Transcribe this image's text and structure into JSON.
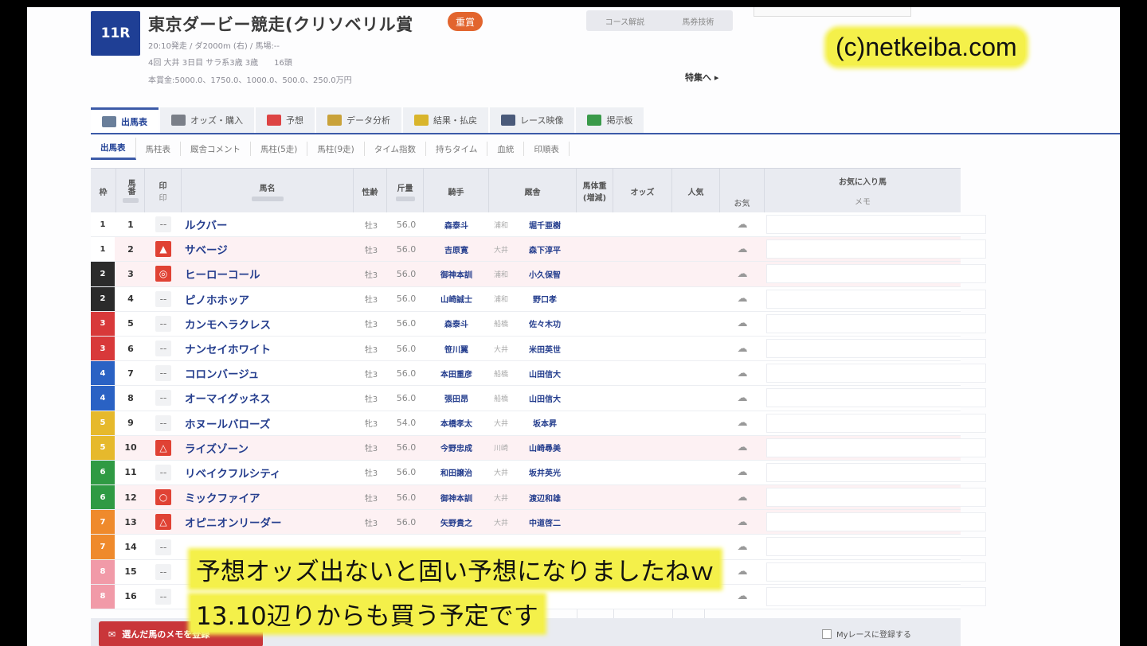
{
  "header": {
    "race_no": "11R",
    "title": "東京ダービー競走(クリソベリル賞",
    "grade": "重賞",
    "meta1": "20:10発走 / ダ2000m (右) / 馬場:--",
    "meta2": "4回 大井 3日目 サラ系3歳 3歳　　16頭",
    "meta3": "本賞金:5000.0、1750.0、1000.0、500.0、250.0万円",
    "course_btn1": "コース解説",
    "course_btn2": "馬券技術",
    "special_link": "特集へ ▸"
  },
  "watermark": "(c)netkeiba.com",
  "tabs": [
    {
      "label": "出馬表",
      "color": "#6a7f9a"
    },
    {
      "label": "オッズ・購入",
      "color": "#7a7f88"
    },
    {
      "label": "予想",
      "color": "#d44"
    },
    {
      "label": "データ分析",
      "color": "#c9a23a"
    },
    {
      "label": "結果・払戻",
      "color": "#d9b52c"
    },
    {
      "label": "レース映像",
      "color": "#4a5a7a"
    },
    {
      "label": "掲示板",
      "color": "#3a9a4a"
    }
  ],
  "subtabs": [
    "出馬表",
    "馬柱表",
    "厩舎コメント",
    "馬柱(5走)",
    "馬柱(9走)",
    "タイム指数",
    "持ちタイム",
    "血統",
    "印順表"
  ],
  "columns": {
    "waku": "枠",
    "uma": "馬番",
    "mark": "印",
    "mark_sub": "印",
    "name": "馬名",
    "sexage": "性齢",
    "weight": "斤量",
    "jockey": "騎手",
    "trainer": "厩舎",
    "bodyweight": "馬体重(増減)",
    "odds": "オッズ",
    "popular": "人気",
    "fav": "お気",
    "memo_head": "お気に入り馬",
    "memo_sub": "メモ"
  },
  "horses": [
    {
      "waku": "1",
      "uma": "1",
      "mark": "--",
      "name": "ルクバー",
      "sexage": "牡3",
      "weight": "56.0",
      "jockey": "森泰斗",
      "region": "浦和",
      "trainer": "堀千亜樹",
      "pink": false,
      "red": false,
      "waku_color": "#ffffff",
      "waku_text": "#333"
    },
    {
      "waku": "1",
      "uma": "2",
      "mark": "▲",
      "name": "サベージ",
      "sexage": "牡3",
      "weight": "56.0",
      "jockey": "吉原寛",
      "region": "大井",
      "trainer": "森下淳平",
      "pink": true,
      "red": true,
      "waku_color": "#ffffff",
      "waku_text": "#333"
    },
    {
      "waku": "2",
      "uma": "3",
      "mark": "◎",
      "name": "ヒーローコール",
      "sexage": "牡3",
      "weight": "56.0",
      "jockey": "御神本訓",
      "region": "浦和",
      "trainer": "小久保智",
      "pink": true,
      "red": true,
      "waku_color": "#2b2b2b",
      "waku_text": "#fff"
    },
    {
      "waku": "2",
      "uma": "4",
      "mark": "--",
      "name": "ピノホホッア",
      "sexage": "牡3",
      "weight": "56.0",
      "jockey": "山崎誠士",
      "region": "浦和",
      "trainer": "野口孝",
      "pink": false,
      "red": false,
      "waku_color": "#2b2b2b",
      "waku_text": "#fff"
    },
    {
      "waku": "3",
      "uma": "5",
      "mark": "--",
      "name": "カンモヘラクレス",
      "sexage": "牡3",
      "weight": "56.0",
      "jockey": "森泰斗",
      "region": "船橋",
      "trainer": "佐々木功",
      "pink": false,
      "red": false,
      "waku_color": "#d8393a",
      "waku_text": "#fff"
    },
    {
      "waku": "3",
      "uma": "6",
      "mark": "--",
      "name": "ナンセイホワイト",
      "sexage": "牡3",
      "weight": "56.0",
      "jockey": "笹川翼",
      "region": "大井",
      "trainer": "米田英世",
      "pink": false,
      "red": false,
      "waku_color": "#d8393a",
      "waku_text": "#fff"
    },
    {
      "waku": "4",
      "uma": "7",
      "mark": "--",
      "name": "コロンバージュ",
      "sexage": "牡3",
      "weight": "56.0",
      "jockey": "本田重彦",
      "region": "船橋",
      "trainer": "山田信大",
      "pink": false,
      "red": false,
      "waku_color": "#2a62c4",
      "waku_text": "#fff"
    },
    {
      "waku": "4",
      "uma": "8",
      "mark": "--",
      "name": "オーマイグッネス",
      "sexage": "牡3",
      "weight": "56.0",
      "jockey": "張田昂",
      "region": "船橋",
      "trainer": "山田信大",
      "pink": false,
      "red": false,
      "waku_color": "#2a62c4",
      "waku_text": "#fff"
    },
    {
      "waku": "5",
      "uma": "9",
      "mark": "--",
      "name": "ホヌールバローズ",
      "sexage": "牝3",
      "weight": "54.0",
      "jockey": "本橋孝太",
      "region": "大井",
      "trainer": "坂本昇",
      "pink": false,
      "red": false,
      "waku_color": "#e6b92c",
      "waku_text": "#fff"
    },
    {
      "waku": "5",
      "uma": "10",
      "mark": "△",
      "name": "ライズゾーン",
      "sexage": "牡3",
      "weight": "56.0",
      "jockey": "今野忠成",
      "region": "川崎",
      "trainer": "山崎尋美",
      "pink": true,
      "red": true,
      "waku_color": "#e6b92c",
      "waku_text": "#fff"
    },
    {
      "waku": "6",
      "uma": "11",
      "mark": "--",
      "name": "リベイクフルシティ",
      "sexage": "牡3",
      "weight": "56.0",
      "jockey": "和田譲治",
      "region": "大井",
      "trainer": "坂井英光",
      "pink": false,
      "red": false,
      "waku_color": "#2f9a43",
      "waku_text": "#fff"
    },
    {
      "waku": "6",
      "uma": "12",
      "mark": "○",
      "name": "ミックファイア",
      "sexage": "牡3",
      "weight": "56.0",
      "jockey": "御神本訓",
      "region": "大井",
      "trainer": "渡辺和雄",
      "pink": true,
      "red": true,
      "waku_color": "#2f9a43",
      "waku_text": "#fff"
    },
    {
      "waku": "7",
      "uma": "13",
      "mark": "△",
      "name": "オピニオンリーダー",
      "sexage": "牡3",
      "weight": "56.0",
      "jockey": "矢野貴之",
      "region": "大井",
      "trainer": "中道啓二",
      "pink": true,
      "red": true,
      "waku_color": "#ef8a2c",
      "waku_text": "#fff"
    },
    {
      "waku": "7",
      "uma": "14",
      "mark": "--",
      "name": "",
      "sexage": "",
      "weight": "",
      "jockey": "",
      "region": "",
      "trainer": "",
      "pink": false,
      "red": false,
      "waku_color": "#ef8a2c",
      "waku_text": "#fff"
    },
    {
      "waku": "8",
      "uma": "15",
      "mark": "--",
      "name": "",
      "sexage": "",
      "weight": "",
      "jockey": "",
      "region": "",
      "trainer": "",
      "pink": false,
      "red": false,
      "waku_color": "#f19aa8",
      "waku_text": "#fff"
    },
    {
      "waku": "8",
      "uma": "16",
      "mark": "--",
      "name": "",
      "sexage": "",
      "weight": "",
      "jockey": "",
      "region": "",
      "trainer": "",
      "pink": false,
      "red": false,
      "waku_color": "#f19aa8",
      "waku_text": "#fff"
    }
  ],
  "footer": {
    "button_label": "選んだ馬のメモを登録",
    "myrace_label": "Myレースに登録する"
  },
  "caption": {
    "line1": "予想オッズ出ないと固い予想になりましたねｗ",
    "line2": "13.10辺りからも買う予定です"
  }
}
